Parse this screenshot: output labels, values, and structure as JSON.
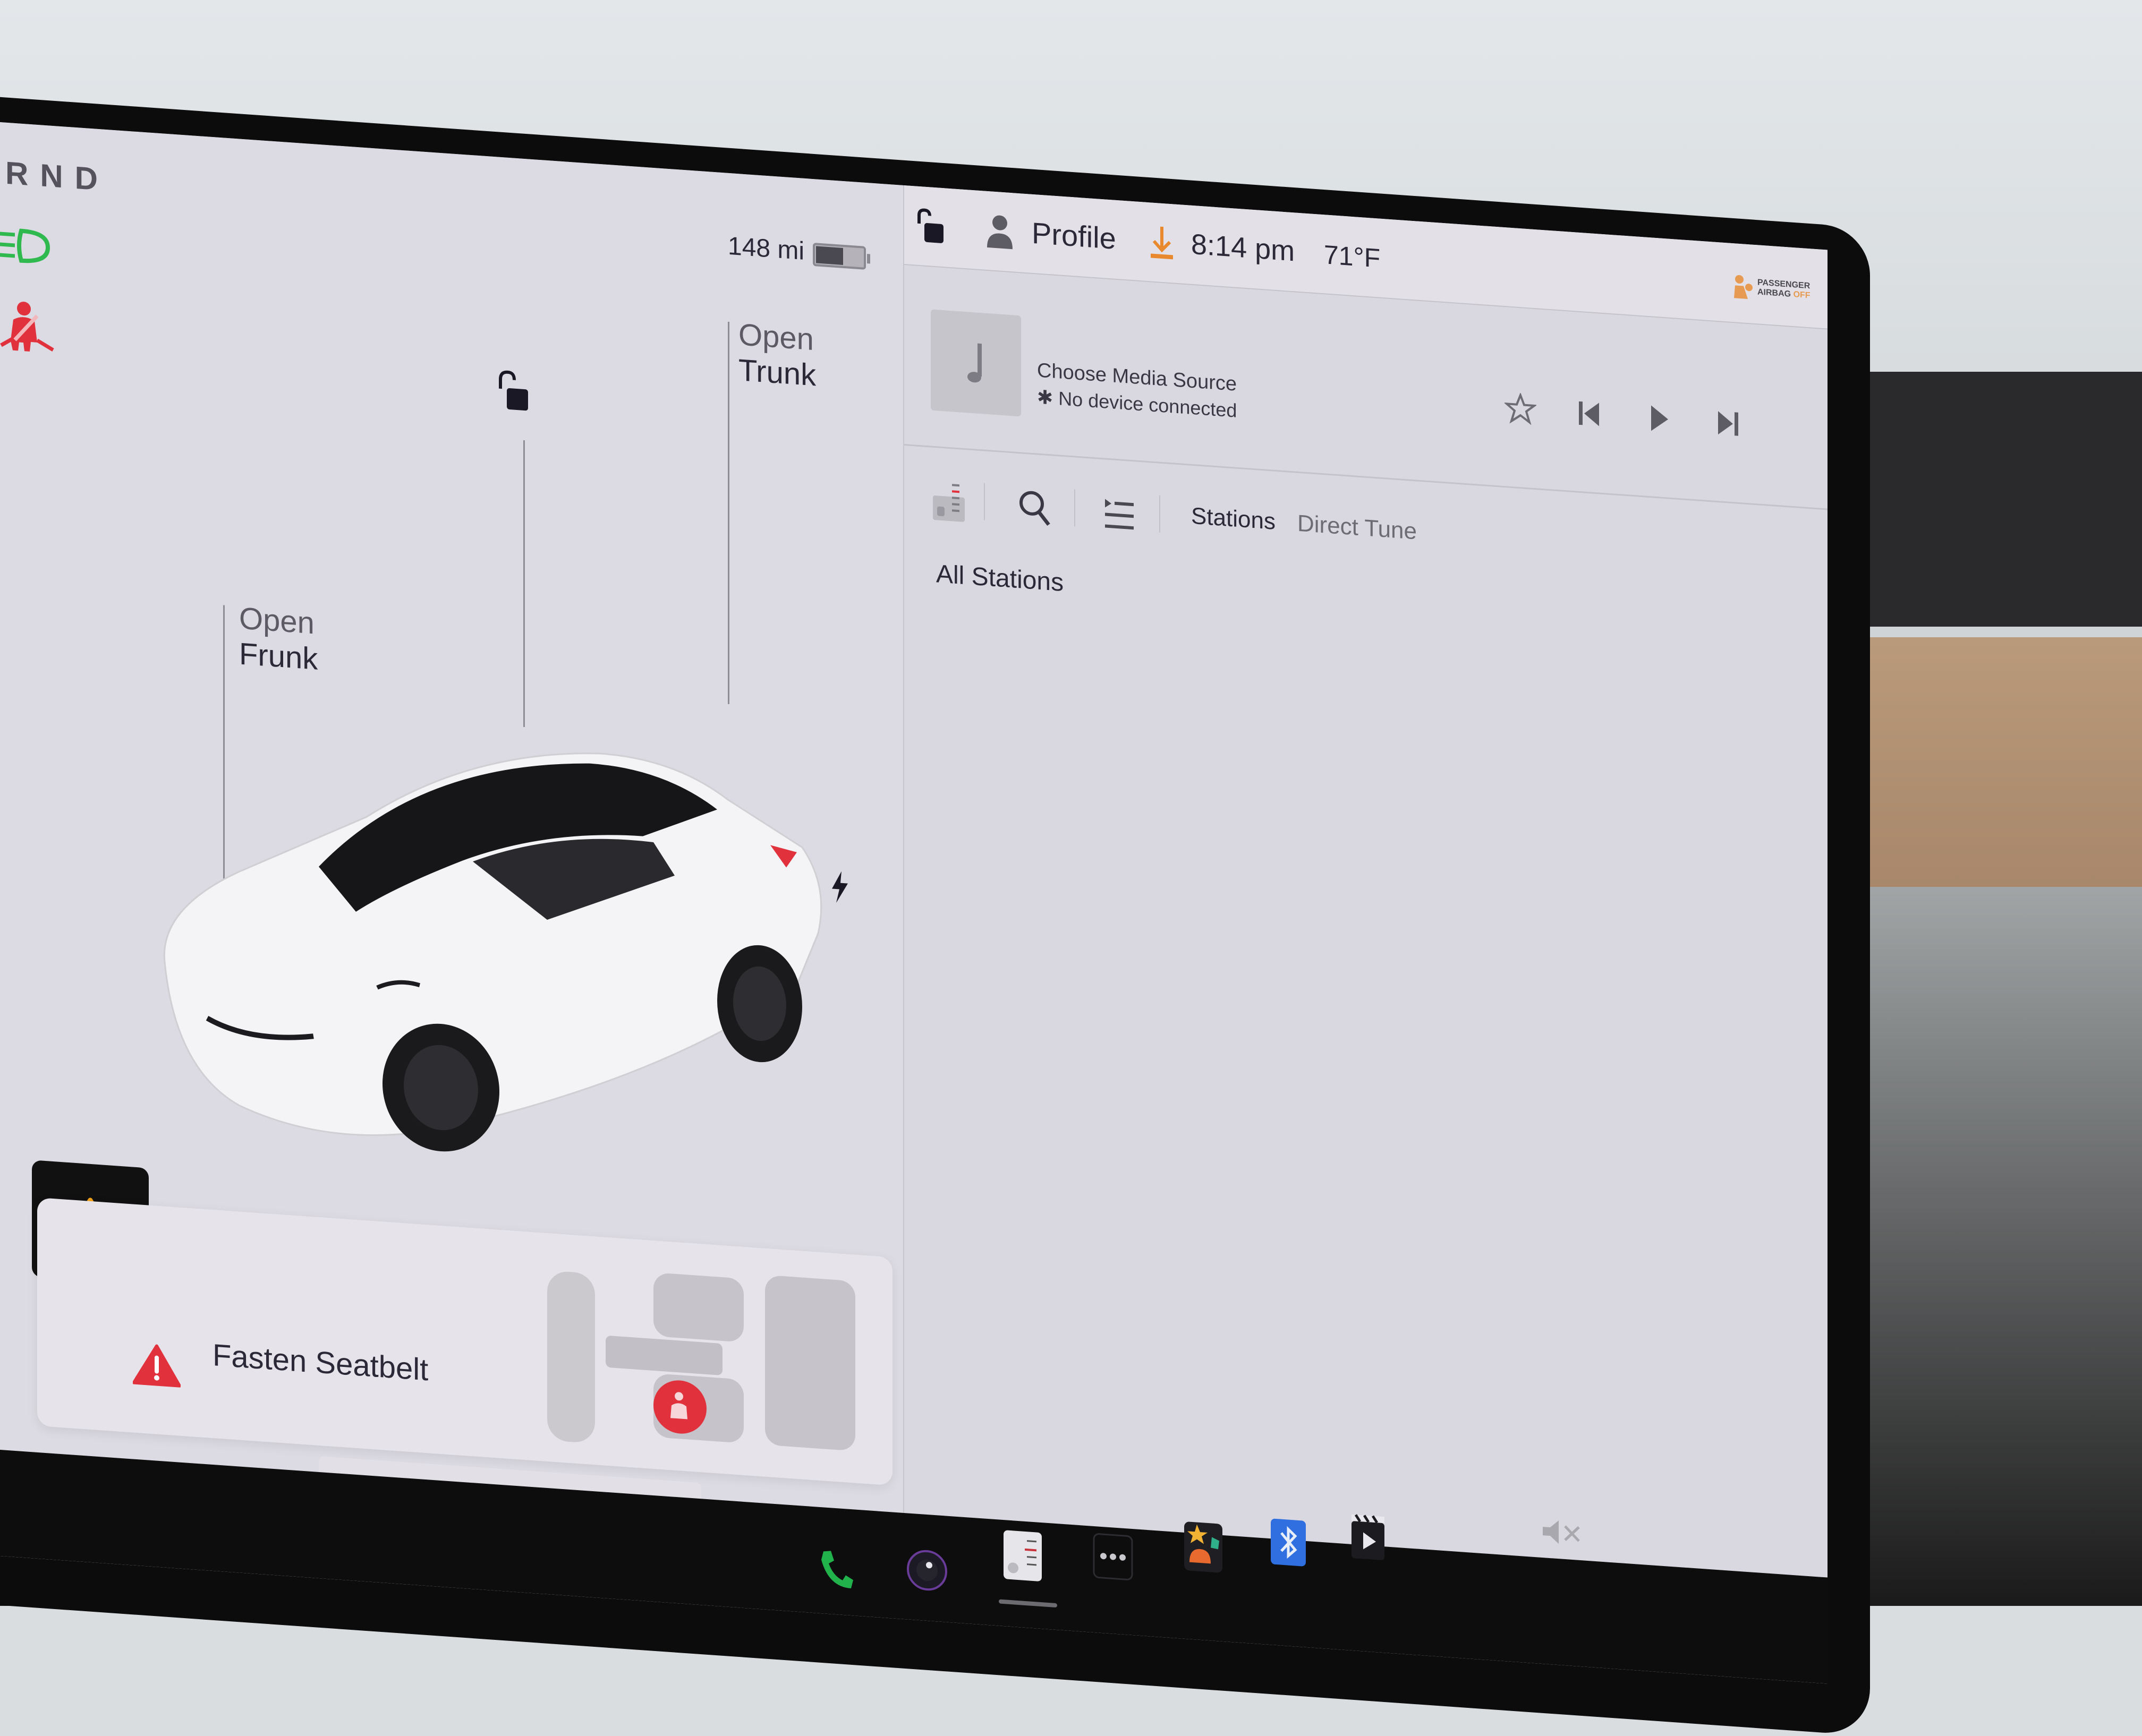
{
  "status_bar": {
    "gear_indicator": "RND",
    "range": "148 mi",
    "battery_level": 0.55,
    "profile_label": "Profile",
    "time": "8:14 pm",
    "temperature": "71°F",
    "airbag_label_line1": "PASSENGER",
    "airbag_label_line2": "AIRBAG",
    "airbag_state": "OFF"
  },
  "telltales": {
    "headlights_color": "#2fb94f",
    "seatbelt_color": "#e0313c"
  },
  "car_panel": {
    "frunk_line1": "Open",
    "frunk_line2": "Frunk",
    "trunk_line1": "Open",
    "trunk_line2": "Trunk"
  },
  "alert": {
    "message": "Fasten Seatbelt",
    "color": "#e0313c"
  },
  "mini_player": {
    "label": "Choose Media Source"
  },
  "media": {
    "source_title": "Choose Media Source",
    "source_subtitle": "No device connected",
    "tabs": [
      {
        "label": "Stations",
        "active": true
      },
      {
        "label": "Direct Tune",
        "active": false
      }
    ],
    "section_title": "All Stations"
  },
  "dock": {
    "items": [
      "phone",
      "camera",
      "radio",
      "more",
      "toybox",
      "bluetooth",
      "theater"
    ],
    "phone_color": "#22b24c",
    "bluetooth_color": "#2f6fe0",
    "volume_state": "muted"
  },
  "colors": {
    "accent_orange": "#e8892e",
    "warning_amber": "#f2a31b"
  }
}
